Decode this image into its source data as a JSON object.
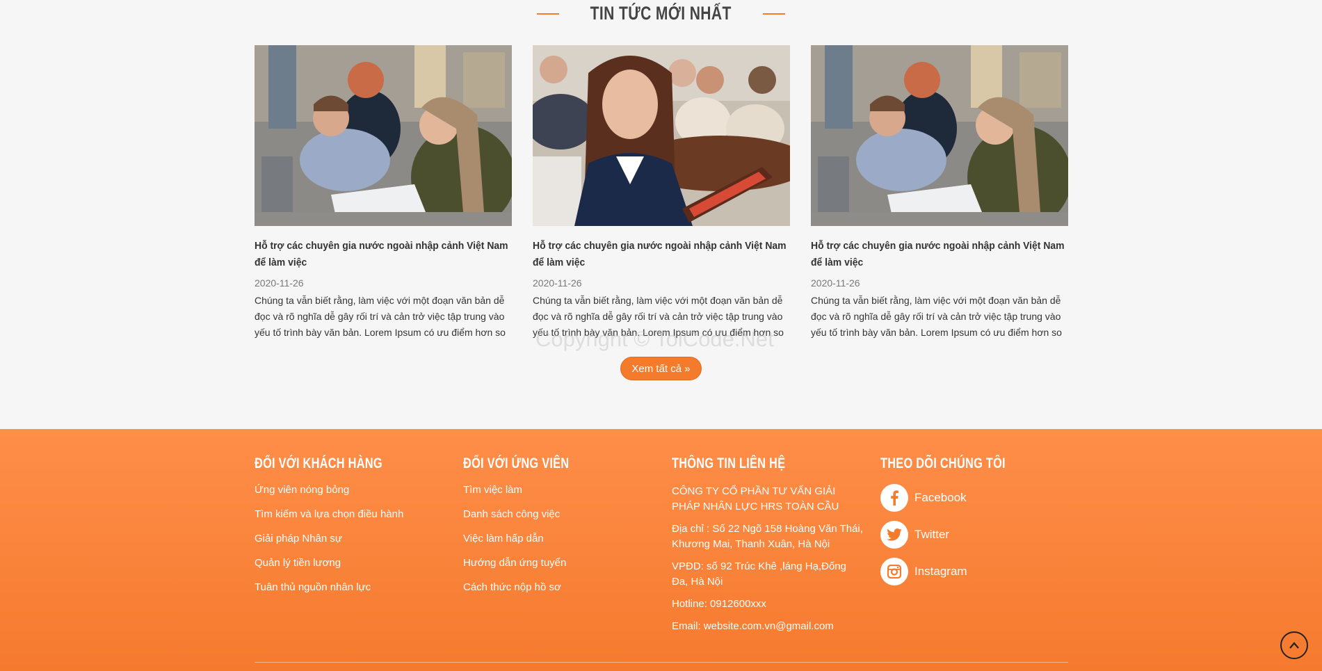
{
  "news": {
    "title": "TIN TỨC MỚI NHẤT",
    "cards": [
      {
        "title": "Hỗ trợ các chuyên gia nước ngoài nhập cảnh Việt Nam để làm việc",
        "date": "2020-11-26",
        "excerpt": "Chúng ta vẫn biết rằng, làm việc với một đoạn văn bản dễ đọc và rõ nghĩa dễ gây rối trí và cản trở việc tập trung vào yếu tố trình bày văn bản. Lorem Ipsum có ưu điểm hơn so",
        "image": "students-studying"
      },
      {
        "title": "Hỗ trợ các chuyên gia nước ngoài nhập cảnh Việt Nam để làm việc",
        "date": "2020-11-26",
        "excerpt": "Chúng ta vẫn biết rằng, làm việc với một đoạn văn bản dễ đọc và rõ nghĩa dễ gây rối trí và cản trở việc tập trung vào yếu tố trình bày văn bản. Lorem Ipsum có ưu điểm hơn so",
        "image": "businesswoman-tablet"
      },
      {
        "title": "Hỗ trợ các chuyên gia nước ngoài nhập cảnh Việt Nam để làm việc",
        "date": "2020-11-26",
        "excerpt": "Chúng ta vẫn biết rằng, làm việc với một đoạn văn bản dễ đọc và rõ nghĩa dễ gây rối trí và cản trở việc tập trung vào yếu tố trình bày văn bản. Lorem Ipsum có ưu điểm hơn so",
        "image": "students-studying"
      }
    ],
    "more_label": "Xem tất cả »",
    "watermark": "Copyright © ToiCode.Net"
  },
  "footer": {
    "customers": {
      "title": "ĐỐI VỚI KHÁCH HÀNG",
      "items": [
        "Ứng viên nóng bỏng",
        "Tìm kiếm và lựa chọn điều hành",
        "Giải pháp Nhân sự",
        "Quản lý tiền lương",
        "Tuân thủ nguồn nhân lực"
      ]
    },
    "candidates": {
      "title": "ĐỐI VỚI ỨNG VIÊN",
      "items": [
        "Tìm việc làm",
        "Danh sách công việc",
        "Việc làm hấp dẫn",
        "Hướng dẫn ứng tuyển",
        "Cách thức nộp hồ sơ"
      ]
    },
    "contact": {
      "title": "THÔNG TIN LIÊN HỆ",
      "company": "CÔNG TY CỔ PHẦN TƯ VẤN GIẢI PHÁP NHÂN LỰC HRS TOÀN CẦU",
      "address": "Địa chỉ : Số 22 Ngõ 158 Hoàng Văn Thái, Khương Mai, Thanh Xuân, Hà Nội",
      "office": "VPĐD: số 92 Trúc Khê ,láng Hạ,Đống Đa, Hà Nội",
      "hotline": "Hotline: 0912600xxx",
      "email": "Email: website.com.vn@gmail.com"
    },
    "follow": {
      "title": "THEO DÕI CHÚNG TÔI",
      "items": [
        {
          "label": "Facebook",
          "icon": "facebook-icon"
        },
        {
          "label": "Twitter",
          "icon": "twitter-icon"
        },
        {
          "label": "Instagram",
          "icon": "instagram-icon"
        }
      ]
    }
  },
  "colors": {
    "accent": "#f47b2c",
    "footer_top": "#ff8e49",
    "footer_bottom": "#f57a2e"
  }
}
